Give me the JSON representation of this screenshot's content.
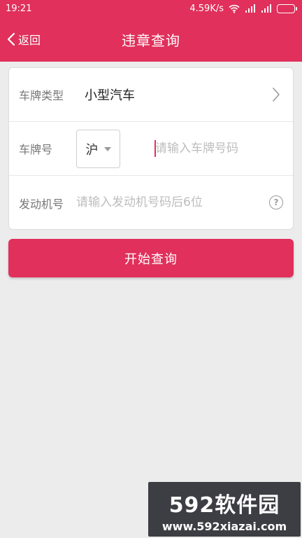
{
  "status_bar": {
    "time": "19:21",
    "network_speed": "4.59K/s"
  },
  "navbar": {
    "back_label": "返回",
    "title": "违章查询"
  },
  "form": {
    "plate_type": {
      "label": "车牌类型",
      "value": "小型汽车"
    },
    "plate_number": {
      "label": "车牌号",
      "province": "沪",
      "placeholder": "请输入车牌号码"
    },
    "engine_number": {
      "label": "发动机号",
      "placeholder": "请输入发动机号码后6位",
      "help_symbol": "?"
    }
  },
  "submit_label": "开始查询",
  "watermark": {
    "brand": "592软件园",
    "url": "www.592xiazai.com"
  },
  "colors": {
    "accent": "#e0305b",
    "background": "#ececec"
  }
}
